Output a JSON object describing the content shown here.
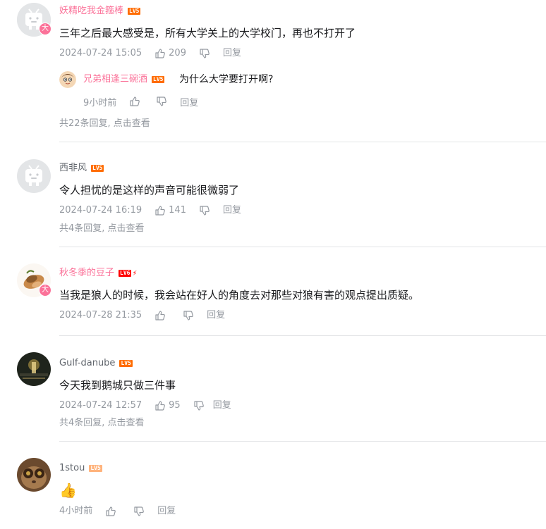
{
  "colors": {
    "accent_pink": "#fb7299",
    "meta_gray": "#9499a0",
    "divider": "#e3e5e7"
  },
  "comments": [
    {
      "user": "妖精吃我金箍棒",
      "level": "LV5",
      "badge": "大",
      "content": "三年之后最大感受是，所有大学关上的大学校门，再也不打开了",
      "date": "2024-07-24 15:05",
      "likes": "209",
      "reply_label": "回复",
      "sub_reply": {
        "user": "兄弟相逢三碗酒",
        "level": "LV5",
        "content": "为什么大学要打开啊?",
        "time": "9小时前",
        "reply_label": "回复"
      },
      "more": "共22条回复, 点击查看"
    },
    {
      "user": "西非风",
      "level": "LV5",
      "content": "令人担忧的是这样的声音可能很微弱了",
      "date": "2024-07-24 16:19",
      "likes": "141",
      "reply_label": "回复",
      "more": "共4条回复, 点击查看"
    },
    {
      "user": "秋冬季的豆子",
      "level": "LV6",
      "badge": "大",
      "content": "当我是狼人的时候，我会站在好人的角度去对那些对狼有害的观点提出质疑。",
      "date": "2024-07-28 21:35",
      "reply_label": "回复"
    },
    {
      "user": "Gulf-danube",
      "level": "LV5",
      "content": "今天我到鹅城只做三件事",
      "date": "2024-07-24 12:57",
      "likes": "95",
      "reply_label": "回复",
      "more": "共4条回复, 点击查看"
    },
    {
      "user": "1stou",
      "level": "LV5",
      "content": "👍",
      "date": "4小时前",
      "reply_label": "回复"
    }
  ]
}
